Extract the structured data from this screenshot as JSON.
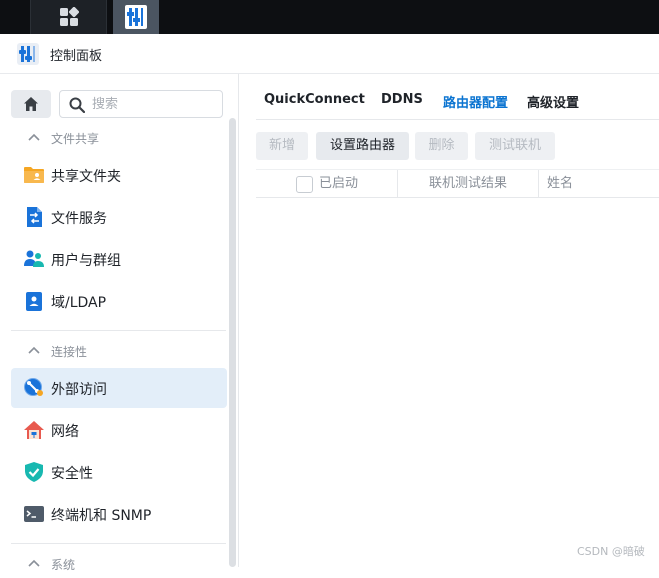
{
  "window": {
    "title": "控制面板"
  },
  "sidebar": {
    "search_placeholder": "搜索",
    "sections": [
      {
        "label": "文件共享",
        "items": [
          {
            "label": "共享文件夹",
            "icon": "shared-folder-icon"
          },
          {
            "label": "文件服务",
            "icon": "file-services-icon"
          },
          {
            "label": "用户与群组",
            "icon": "users-icon"
          },
          {
            "label": "域/LDAP",
            "icon": "domain-icon"
          }
        ]
      },
      {
        "label": "连接性",
        "items": [
          {
            "label": "外部访问",
            "icon": "external-access-icon",
            "active": true
          },
          {
            "label": "网络",
            "icon": "network-icon"
          },
          {
            "label": "安全性",
            "icon": "security-shield-icon"
          },
          {
            "label": "终端机和 SNMP",
            "icon": "terminal-icon"
          }
        ]
      },
      {
        "label": "系统",
        "items": []
      }
    ]
  },
  "tabs": [
    {
      "label": "QuickConnect"
    },
    {
      "label": "DDNS"
    },
    {
      "label": "路由器配置",
      "active": true
    },
    {
      "label": "高级设置"
    }
  ],
  "toolbar": {
    "add": "新增",
    "setup_router": "设置路由器",
    "delete": "删除",
    "test_connection": "测试联机"
  },
  "table": {
    "columns": [
      "已启动",
      "联机测试结果",
      "姓名"
    ]
  },
  "watermark": "CSDN @暗破",
  "colors": {
    "accent": "#0b74d1",
    "active_bg": "#e3eef9",
    "taskbar": "#0d0f12"
  }
}
